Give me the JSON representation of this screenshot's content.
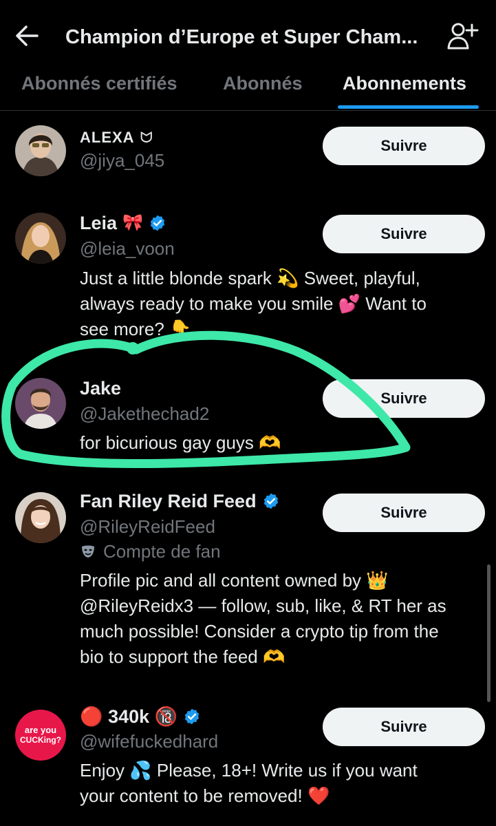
{
  "header": {
    "back_icon": "arrow-left-icon",
    "title": "Champion d’Europe et Super Cham...",
    "add_user_icon": "add-user-icon"
  },
  "tabs": [
    {
      "label": "Abonnés certifiés",
      "active": false
    },
    {
      "label": "Abonnés",
      "active": false
    },
    {
      "label": "Abonnements",
      "active": true
    }
  ],
  "follow_label": "Suivre",
  "accounts": [
    {
      "name": "ALEXA",
      "name_suffix": "ᗢ",
      "handle": "@jiya_045",
      "bio": []
    },
    {
      "name": "Leia",
      "verified": true,
      "handle": "@leia_voon",
      "bio": [
        "Just a little blonde spark 💫 Sweet, playful,",
        "always ready to make you smile 💕 Want to",
        "see more? 👇"
      ]
    },
    {
      "name": "Jake",
      "handle": "@Jakethechad2",
      "bio": [
        "for bicurious gay guys 🫶"
      ]
    },
    {
      "name": "Fan Riley Reid Feed",
      "verified": true,
      "handle": "@RileyReidFeed",
      "label": "Compte de fan",
      "label_icon": "mask-icon",
      "bio": [
        "Profile pic and all content owned by 👑",
        "@RileyReidx3 — follow, sub, like, & RT her as",
        "much possible! Consider a crypto tip from the",
        "bio to support the feed 🫶"
      ]
    },
    {
      "name": "🔴 340k 🔞",
      "verified": true,
      "handle": "@wifefuckedhard",
      "avatar_text": [
        "are you",
        "CUCKing?"
      ],
      "bio": [
        "Enjoy 💦 Please, 18+! Write us if you want",
        "your content to be removed! ❤️"
      ]
    }
  ],
  "colors": {
    "background": "#000000",
    "accent": "#1d9bf0",
    "secondary_text": "#71767b",
    "button_bg": "#eff3f4",
    "annotation": "#3de8a8"
  }
}
